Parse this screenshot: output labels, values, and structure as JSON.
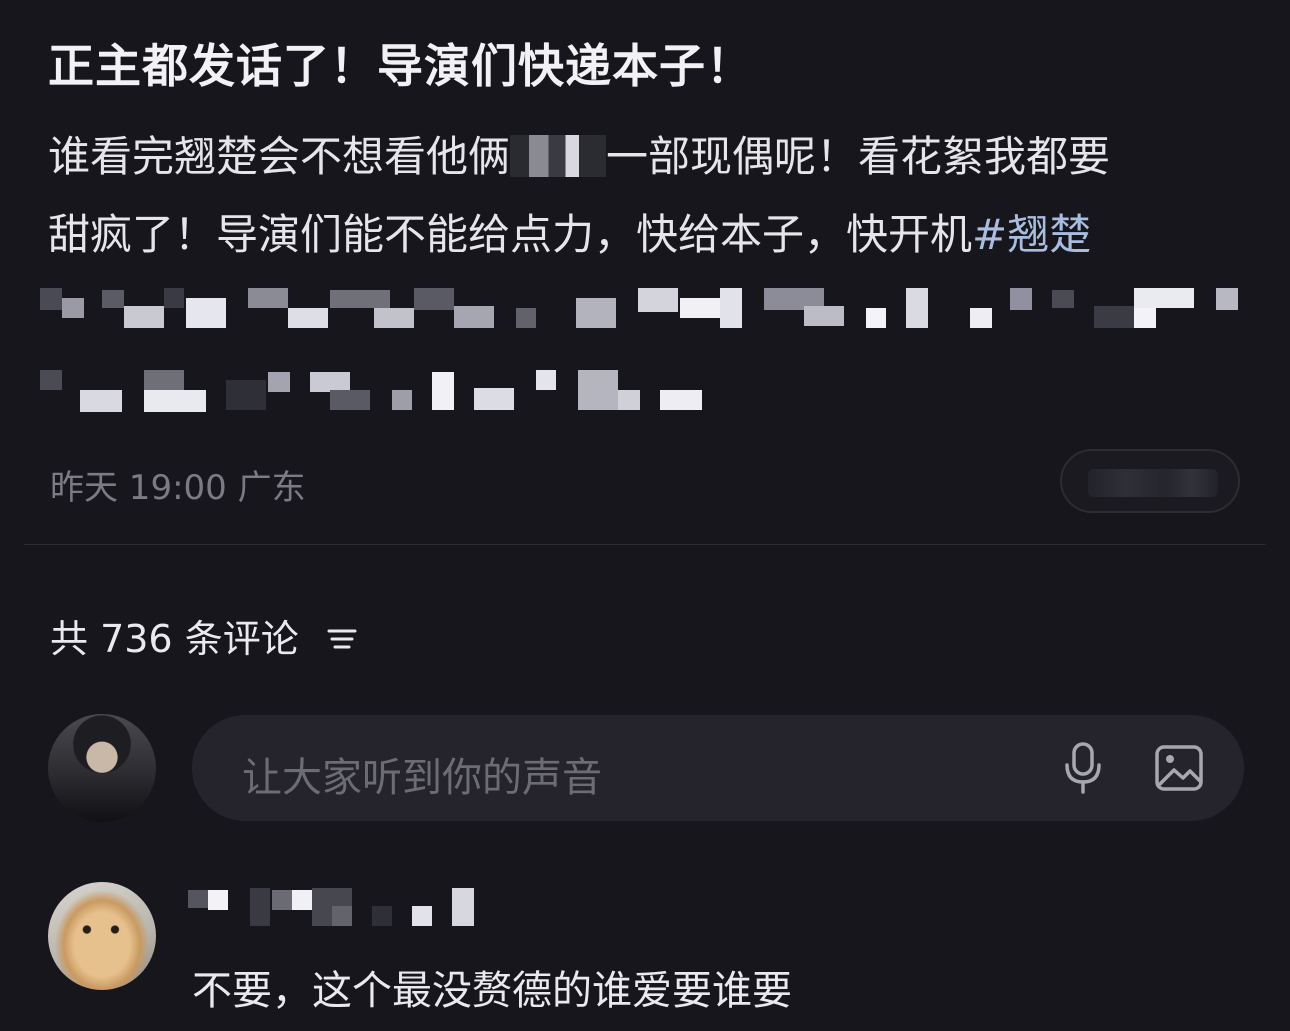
{
  "post": {
    "title": "正主都发话了！导演们快递本子！",
    "body_line1_a": "谁看完翘楚会不想看他俩",
    "body_line1_b": "一部现偶呢！看花絮我都要",
    "body_line2_text": "甜疯了！导演们能不能给点力，快给本子，快开机",
    "body_line2_hashtag": "#翘楚",
    "meta": "昨天 19:00 广东"
  },
  "comments": {
    "count_label": "共 736 条评论",
    "input_placeholder": "让大家听到你的声音",
    "first_comment_text": "不要，这个最没赘德的谁爱要谁要"
  },
  "icons": {
    "sort": "sort-icon",
    "mic": "microphone-icon",
    "image": "image-icon"
  },
  "colors": {
    "background": "#17161d",
    "hashtag": "#a9bde0",
    "input_bg": "#25242c",
    "muted_text": "#7b7b84"
  }
}
